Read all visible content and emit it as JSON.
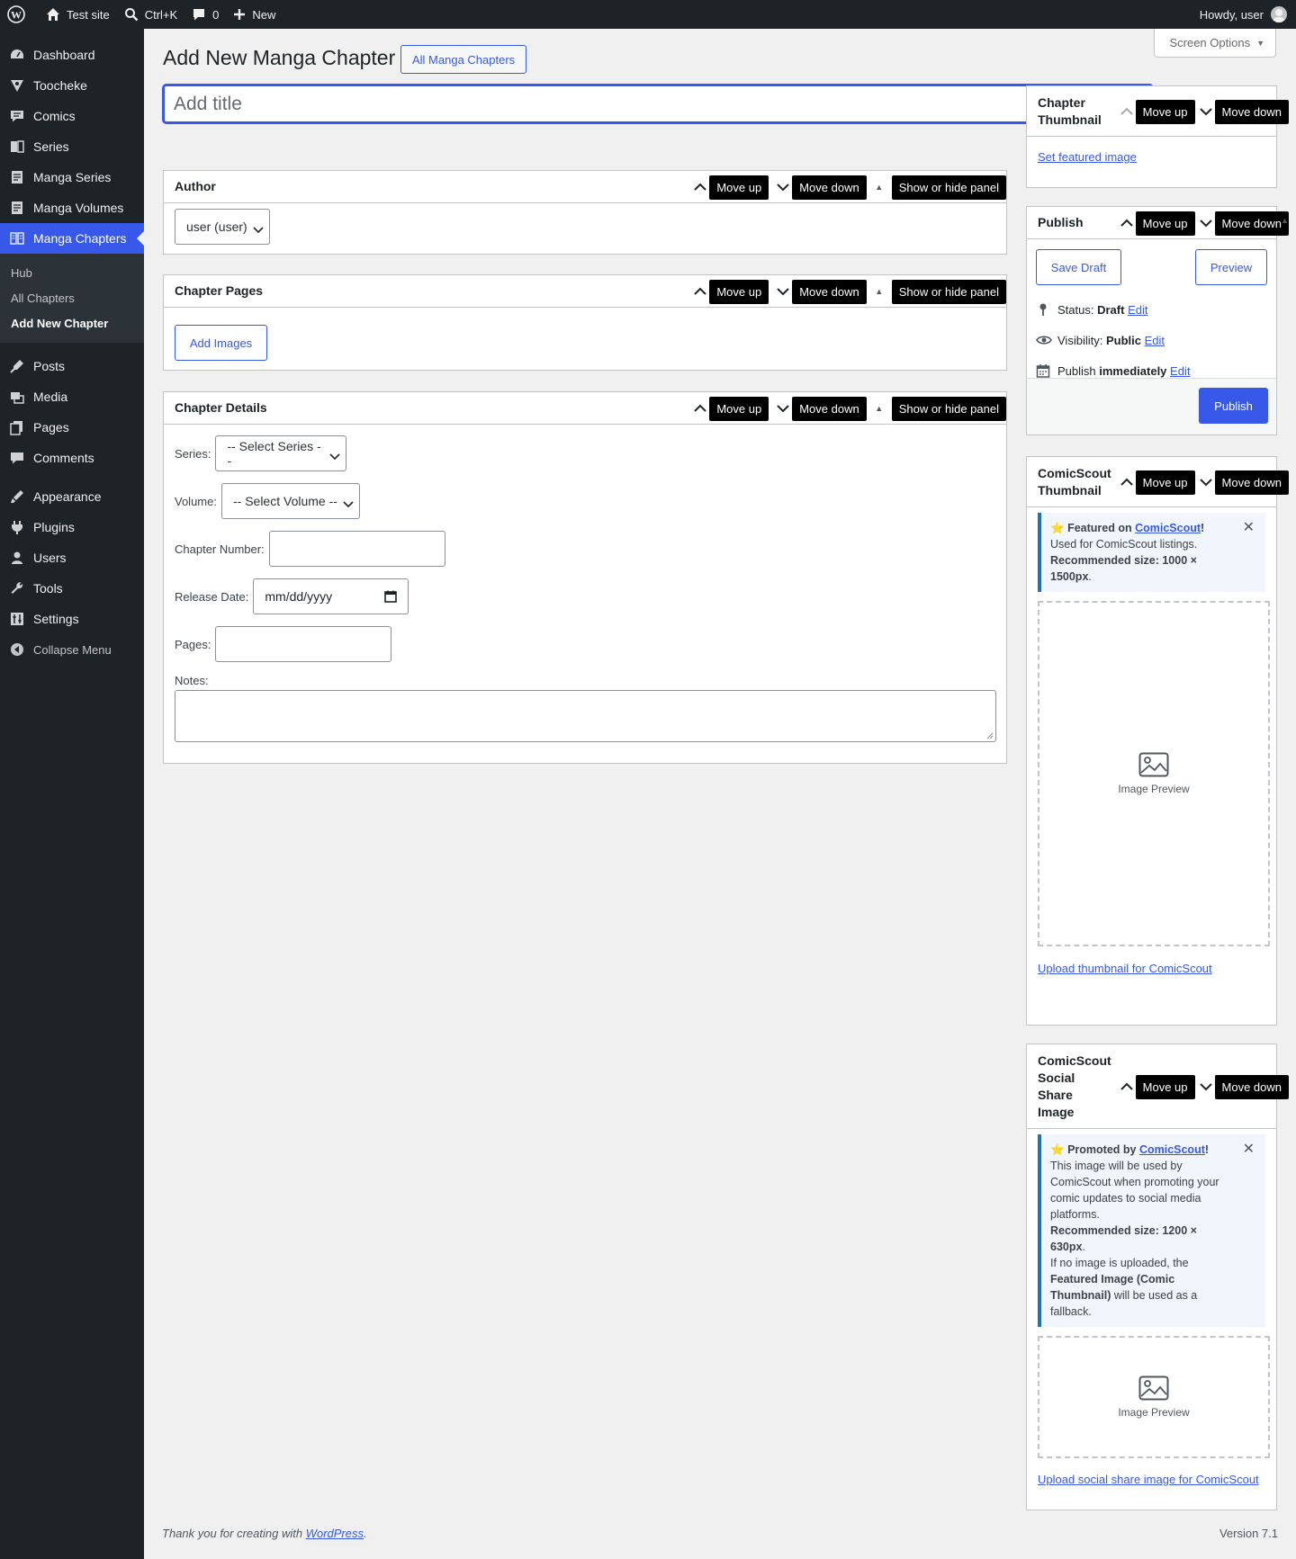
{
  "adminbar": {
    "site_name": "Test site",
    "search_shortcut": "Ctrl+K",
    "comments_count": "0",
    "new_label": "New",
    "howdy": "Howdy, user"
  },
  "sidebar": {
    "items": [
      {
        "label": "Dashboard",
        "icon": "dashboard-icon"
      },
      {
        "label": "Toocheke",
        "icon": "toocheke-icon"
      },
      {
        "label": "Comics",
        "icon": "comics-icon"
      },
      {
        "label": "Series",
        "icon": "series-icon"
      },
      {
        "label": "Manga Series",
        "icon": "manga-series-icon"
      },
      {
        "label": "Manga Volumes",
        "icon": "manga-volumes-icon"
      },
      {
        "label": "Manga Chapters",
        "icon": "manga-chapters-icon"
      }
    ],
    "submenu": [
      "Hub",
      "All Chapters",
      "Add New Chapter"
    ],
    "items2": [
      {
        "label": "Posts",
        "icon": "posts-icon"
      },
      {
        "label": "Media",
        "icon": "media-icon"
      },
      {
        "label": "Pages",
        "icon": "pages-icon"
      },
      {
        "label": "Comments",
        "icon": "comments-icon"
      }
    ],
    "items3": [
      {
        "label": "Appearance",
        "icon": "appearance-icon"
      },
      {
        "label": "Plugins",
        "icon": "plugins-icon"
      },
      {
        "label": "Users",
        "icon": "users-icon"
      },
      {
        "label": "Tools",
        "icon": "tools-icon"
      },
      {
        "label": "Settings",
        "icon": "settings-icon"
      }
    ],
    "collapse": "Collapse Menu"
  },
  "page": {
    "screen_options": "Screen Options",
    "title": "Add New Manga Chapter",
    "all_chapters_button": "All Manga Chapters",
    "title_placeholder": "Add title"
  },
  "controls": {
    "move_up": "Move up",
    "move_down": "Move down",
    "toggle": "Show or hide panel"
  },
  "author_box": {
    "title": "Author",
    "selected": "user (user)"
  },
  "pages_box": {
    "title": "Chapter Pages",
    "add_images": "Add Images"
  },
  "details_box": {
    "title": "Chapter Details",
    "series_label": "Series:",
    "series_selected": "-- Select Series --",
    "volume_label": "Volume:",
    "volume_selected": "-- Select Volume --",
    "chapter_number_label": "Chapter Number:",
    "release_date_label": "Release Date:",
    "release_date_placeholder": "mm/dd/yyyy",
    "pages_label": "Pages:",
    "notes_label": "Notes:"
  },
  "thumbnail_box": {
    "title_line1": "Chapter",
    "title_line2": "Thumbnail",
    "set_featured": "Set featured image"
  },
  "publish_box": {
    "title": "Publish",
    "save_draft": "Save Draft",
    "preview": "Preview",
    "status_label": "Status:",
    "status_value": "Draft",
    "visibility_label": "Visibility:",
    "visibility_value": "Public",
    "publish_label": "Publish",
    "publish_value": "immediately",
    "edit": "Edit",
    "publish_button": "Publish"
  },
  "cs_thumb_box": {
    "title_line1": "ComicScout",
    "title_line2": "Thumbnail",
    "notice_prefix": "Featured on ",
    "notice_link": "ComicScout",
    "notice_bang": "!",
    "notice_line2": "Used for ComicScout listings.",
    "notice_rec": "Recommended size: 1000 × 1500px",
    "notice_dot": ".",
    "preview_label": "Image Preview",
    "upload_link": "Upload thumbnail for ComicScout"
  },
  "cs_social_box": {
    "title_line1": "ComicScout",
    "title_line2": "Social",
    "title_line3": "Share",
    "title_line4": "Image",
    "notice_prefix": "Promoted by ",
    "notice_link": "ComicScout",
    "notice_bang": "!",
    "notice_body": "This image will be used by ComicScout when promoting your comic updates to social media platforms.",
    "notice_rec": "Recommended size: 1200 × 630px",
    "notice_dot": ".",
    "notice_fallback_pre": "If no image is uploaded, the ",
    "notice_fallback_bold": "Featured Image (Comic Thumbnail)",
    "notice_fallback_post": " will be used as a fallback.",
    "preview_label": "Image Preview",
    "upload_link": "Upload social share image for ComicScout"
  },
  "footer": {
    "thanks_pre": "Thank you for creating with ",
    "thanks_link": "WordPress",
    "thanks_post": ".",
    "version": "Version 7.1"
  },
  "colors": {
    "accent": "#3858e9",
    "admin_dark": "#1d2327",
    "background": "#f0f0f1"
  }
}
